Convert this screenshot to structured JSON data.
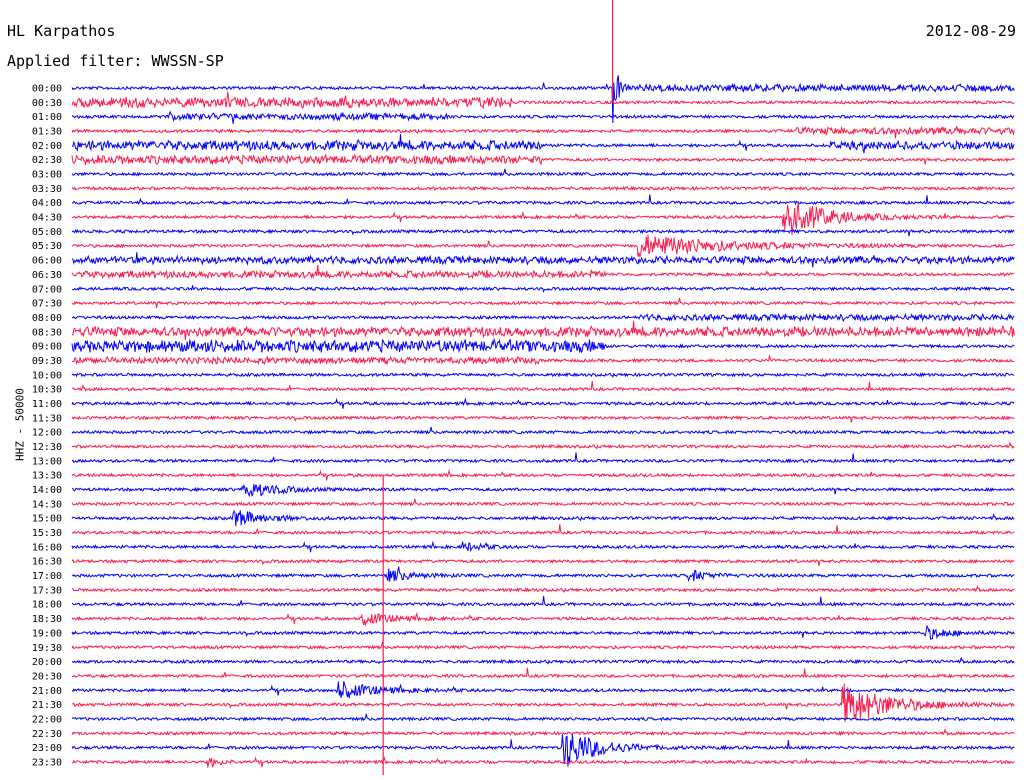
{
  "header": {
    "station": "HL Karpathos",
    "date": "2012-08-29",
    "filter": "Applied filter: WWSSN-SP",
    "channel": "HHZ - 50000"
  },
  "colors": {
    "even_trace": "#0000ff",
    "odd_trace": "#ff1a4d",
    "background": "#ffffff",
    "text": "#000000"
  },
  "chart_data": {
    "type": "line",
    "title": "HL Karpathos",
    "subtitle": "Applied filter: WWSSN-SP",
    "ylabel": "HHZ - 50000",
    "row_labels": [
      "00:00",
      "00:30",
      "01:00",
      "01:30",
      "02:00",
      "02:30",
      "03:00",
      "03:30",
      "04:00",
      "04:30",
      "05:00",
      "05:30",
      "06:00",
      "06:30",
      "07:00",
      "07:30",
      "08:00",
      "08:30",
      "09:00",
      "09:30",
      "10:00",
      "10:30",
      "11:00",
      "11:30",
      "12:00",
      "12:30",
      "13:00",
      "13:30",
      "14:00",
      "14:30",
      "15:00",
      "15:30",
      "16:00",
      "16:30",
      "17:00",
      "17:30",
      "18:00",
      "18:30",
      "19:00",
      "19:30",
      "20:00",
      "20:30",
      "21:00",
      "21:30",
      "22:00",
      "22:30",
      "23:00",
      "23:30"
    ],
    "row_duration_min": 30,
    "color_pattern": [
      "blue",
      "red"
    ],
    "noise_bursts": [
      {
        "row": 1,
        "from_min": 0,
        "to_min": 14,
        "level": 3.2
      },
      {
        "row": 0,
        "from_min": 18,
        "to_min": 30,
        "level": 1.8
      },
      {
        "row": 2,
        "from_min": 3,
        "to_min": 12,
        "level": 1.6
      },
      {
        "row": 3,
        "from_min": 23,
        "to_min": 30,
        "level": 2.0
      },
      {
        "row": 4,
        "from_min": 0,
        "to_min": 15,
        "level": 3.0
      },
      {
        "row": 4,
        "from_min": 24,
        "to_min": 30,
        "level": 2.2
      },
      {
        "row": 5,
        "from_min": 0,
        "to_min": 15,
        "level": 2.5
      },
      {
        "row": 12,
        "from_min": 0,
        "to_min": 30,
        "level": 2.0
      },
      {
        "row": 13,
        "from_min": 0,
        "to_min": 17,
        "level": 1.8
      },
      {
        "row": 16,
        "from_min": 18,
        "to_min": 30,
        "level": 1.5
      },
      {
        "row": 17,
        "from_min": 0,
        "to_min": 30,
        "level": 3.0
      },
      {
        "row": 18,
        "from_min": 0,
        "to_min": 17,
        "level": 4.0
      },
      {
        "row": 19,
        "from_min": 0,
        "to_min": 15,
        "level": 1.6
      }
    ],
    "events": [
      {
        "row": 0,
        "min": 17.2,
        "amp": 40,
        "decay_min": 0.15
      },
      {
        "row": 9,
        "min": 22.6,
        "amp": 22,
        "decay_min": 1.2
      },
      {
        "row": 11,
        "min": 18.0,
        "amp": 12,
        "decay_min": 2.5
      },
      {
        "row": 28,
        "min": 5.4,
        "amp": 10,
        "decay_min": 0.9
      },
      {
        "row": 30,
        "min": 5.1,
        "amp": 9,
        "decay_min": 0.9
      },
      {
        "row": 32,
        "min": 12.4,
        "amp": 5,
        "decay_min": 0.5
      },
      {
        "row": 34,
        "min": 10.0,
        "amp": 7,
        "decay_min": 0.7
      },
      {
        "row": 34,
        "min": 19.6,
        "amp": 6,
        "decay_min": 0.6
      },
      {
        "row": 37,
        "min": 9.2,
        "amp": 7,
        "decay_min": 0.8
      },
      {
        "row": 38,
        "min": 27.1,
        "amp": 7,
        "decay_min": 0.7
      },
      {
        "row": 42,
        "min": 8.4,
        "amp": 10,
        "decay_min": 1.0
      },
      {
        "row": 43,
        "min": 24.5,
        "amp": 22,
        "decay_min": 1.4
      },
      {
        "row": 46,
        "min": 15.6,
        "amp": 22,
        "decay_min": 1.0
      },
      {
        "row": 47,
        "min": 4.3,
        "amp": 5,
        "decay_min": 0.4
      }
    ]
  }
}
